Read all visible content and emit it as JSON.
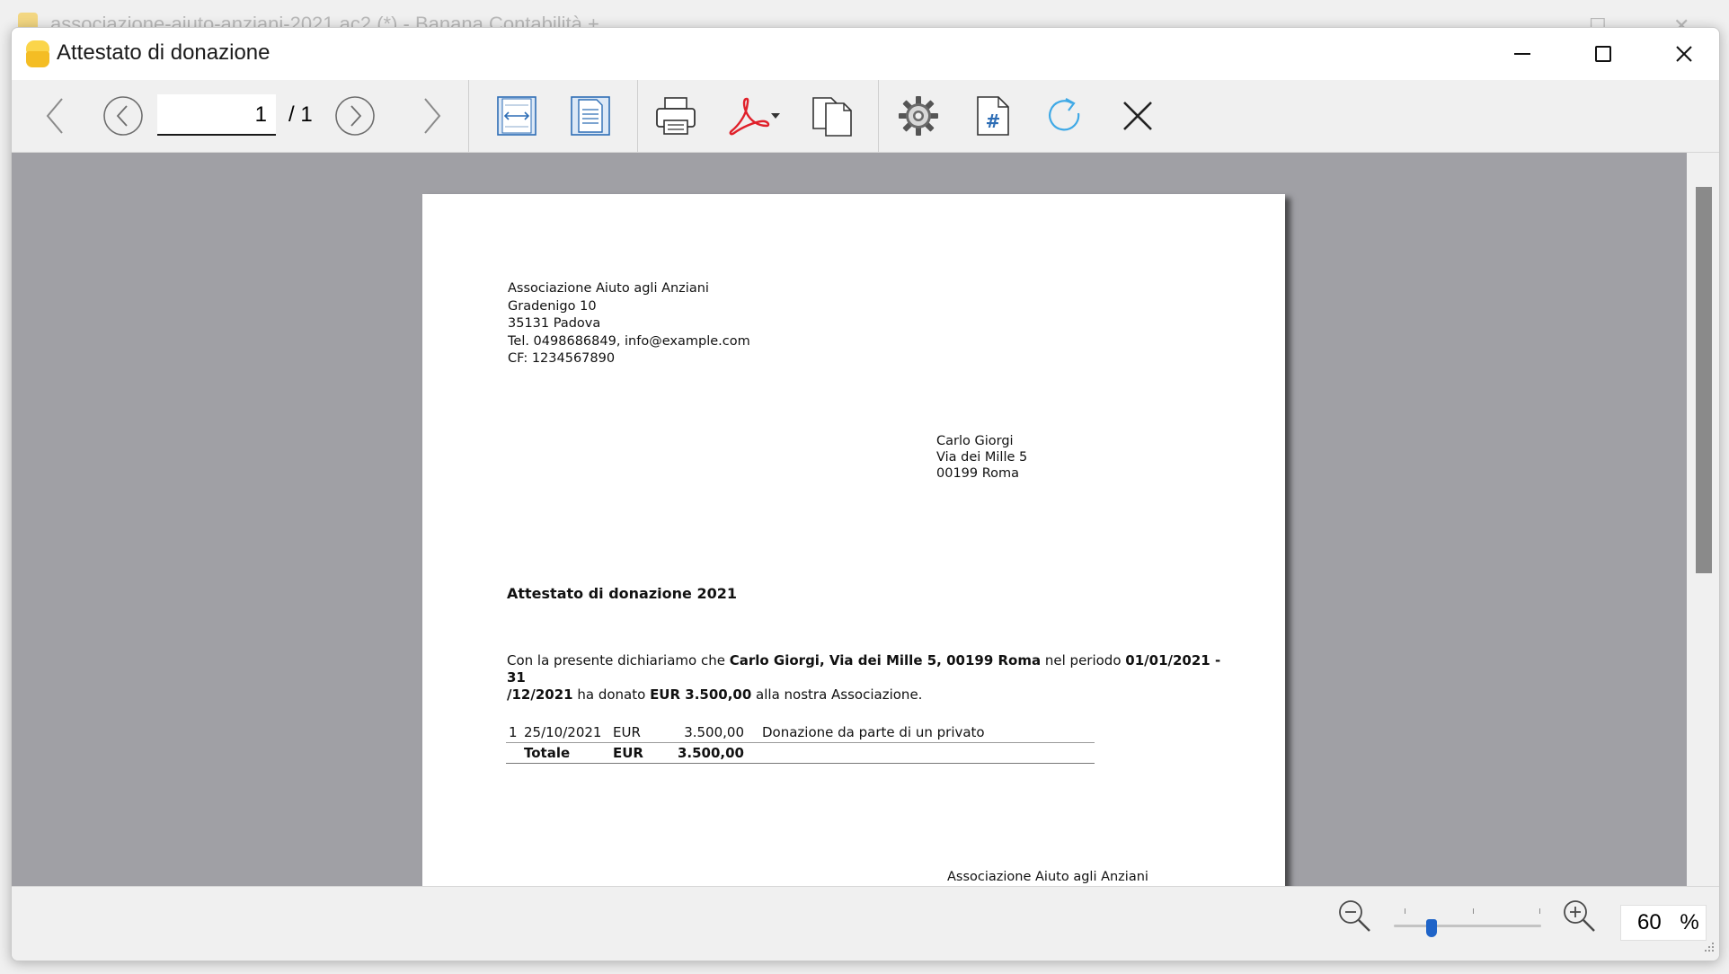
{
  "background_window": {
    "title": "associazione-aiuto-anziani-2021.ac2 (*) - Banana Contabilità +"
  },
  "dialog": {
    "title": "Attestato di donazione",
    "controls": {
      "minimize": "minimize-icon",
      "maximize": "maximize-icon",
      "close": "close-icon"
    }
  },
  "toolbar": {
    "page_current": "1",
    "page_total": "/ 1",
    "icons": [
      "chevron-left-icon",
      "circle-prev-icon",
      "circle-next-icon",
      "chevron-right-icon",
      "fit-width-icon",
      "fit-page-icon",
      "print-icon",
      "pdf-icon",
      "copy-icon",
      "settings-icon",
      "hash-icon",
      "refresh-icon",
      "close-icon"
    ]
  },
  "document": {
    "sender": {
      "name": "Associazione Aiuto agli Anziani",
      "street": "Gradenigo 10",
      "city": "35131 Padova",
      "contact": "Tel. 0498686849, info@example.com",
      "cf": "CF: 1234567890"
    },
    "recipient": {
      "name": "Carlo Giorgi",
      "street": "Via dei Mille 5",
      "city": "00199 Roma"
    },
    "title": "Attestato di donazione 2021",
    "body": {
      "part1": "Con la presente dichiariamo che ",
      "donor": "Carlo Giorgi, Via dei Mille 5, 00199 Roma",
      "part2": " nel periodo ",
      "period_start": "01/01/2021 - 31",
      "period_end": "/12/2021",
      "part3": " ha donato ",
      "amount": "EUR 3.500,00",
      "part4": " alla nostra Associazione."
    },
    "table": {
      "rows": [
        {
          "num": "1",
          "date": "25/10/2021",
          "currency": "EUR",
          "amount": "3.500,00",
          "description": "Donazione da parte di un privato"
        }
      ],
      "total": {
        "label": "Totale",
        "currency": "EUR",
        "amount": "3.500,00"
      }
    },
    "signature": "Associazione Aiuto agli Anziani"
  },
  "statusbar": {
    "zoom_value": "60",
    "zoom_unit": "%",
    "zoom_percent": 60
  },
  "colors": {
    "accent": "#1f64c8",
    "viewer_background": "#a0a0a5",
    "pdf_red": "#e0202a",
    "logo_yellow": "#f4bd24",
    "refresh_blue": "#3fa9e6"
  }
}
